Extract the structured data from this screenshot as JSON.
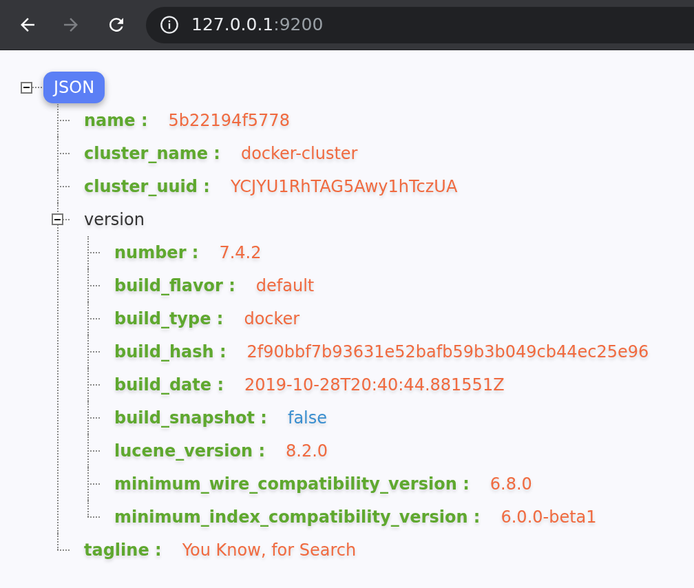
{
  "browser": {
    "back_enabled": true,
    "forward_enabled": false,
    "host": "127.0.0.1",
    "port": ":9200"
  },
  "tree": {
    "label": "JSON",
    "expanded": true,
    "children": [
      {
        "kind": "string",
        "key": "name :",
        "value": "5b22194f5778"
      },
      {
        "kind": "string",
        "key": "cluster_name :",
        "value": "docker-cluster"
      },
      {
        "kind": "string",
        "key": "cluster_uuid :",
        "value": "YCJYU1RhTAG5Awy1hTczUA"
      },
      {
        "kind": "object",
        "key": "version",
        "expanded": true,
        "children": [
          {
            "kind": "string",
            "key": "number :",
            "value": "7.4.2"
          },
          {
            "kind": "string",
            "key": "build_flavor :",
            "value": "default"
          },
          {
            "kind": "string",
            "key": "build_type :",
            "value": "docker"
          },
          {
            "kind": "string",
            "key": "build_hash :",
            "value": "2f90bbf7b93631e52bafb59b3b049cb44ec25e96"
          },
          {
            "kind": "string",
            "key": "build_date :",
            "value": "2019-10-28T20:40:44.881551Z"
          },
          {
            "kind": "boolean",
            "key": "build_snapshot :",
            "value": "false"
          },
          {
            "kind": "string",
            "key": "lucene_version :",
            "value": "8.2.0"
          },
          {
            "kind": "string",
            "key": "minimum_wire_compatibility_version :",
            "value": "6.8.0"
          },
          {
            "kind": "string",
            "key": "minimum_index_compatibility_version :",
            "value": "6.0.0-beta1"
          }
        ]
      },
      {
        "kind": "string",
        "key": "tagline :",
        "value": "You Know, for Search"
      }
    ]
  }
}
